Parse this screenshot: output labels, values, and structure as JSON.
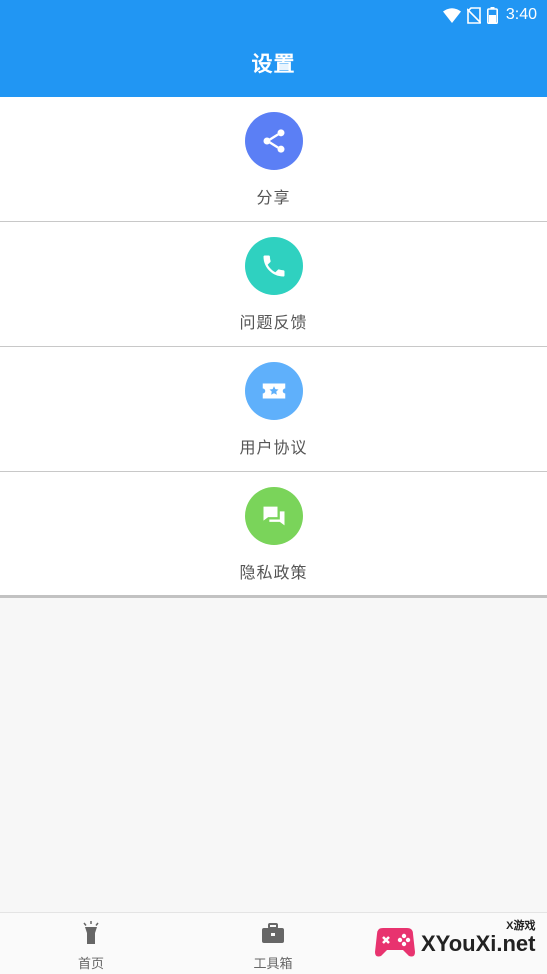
{
  "status_bar": {
    "time": "3:40"
  },
  "header": {
    "title": "设置"
  },
  "menu": {
    "items": [
      {
        "label": "分享",
        "icon": "share-icon",
        "color": "#5b7ff5"
      },
      {
        "label": "问题反馈",
        "icon": "phone-icon",
        "color": "#2fd1c0"
      },
      {
        "label": "用户协议",
        "icon": "ticket-star-icon",
        "color": "#5fb0fb"
      },
      {
        "label": "隐私政策",
        "icon": "chat-icon",
        "color": "#7ad45a"
      }
    ]
  },
  "tab_bar": {
    "tabs": [
      {
        "label": "首页",
        "icon": "flashlight-icon"
      },
      {
        "label": "工具箱",
        "icon": "toolbox-icon"
      }
    ]
  },
  "watermark": {
    "text": "XYouXi.net",
    "sub": "X游戏"
  }
}
